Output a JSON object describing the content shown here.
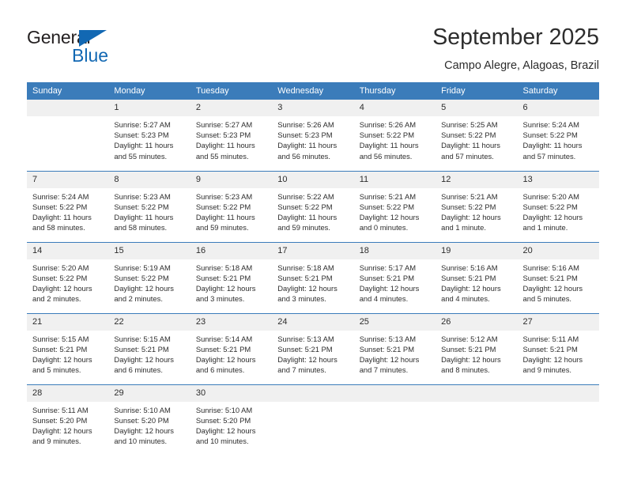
{
  "brand": {
    "name_part1": "General",
    "name_part2": "Blue",
    "accent_color": "#1268b3"
  },
  "header": {
    "title": "September 2025",
    "subtitle": "Campo Alegre, Alagoas, Brazil"
  },
  "calendar": {
    "header_color": "#3b7cba",
    "weekday_headers": [
      "Sunday",
      "Monday",
      "Tuesday",
      "Wednesday",
      "Thursday",
      "Friday",
      "Saturday"
    ],
    "weeks": [
      [
        {
          "day": "",
          "sunrise": "",
          "sunset": "",
          "daylight1": "",
          "daylight2": "",
          "blank": true
        },
        {
          "day": "1",
          "sunrise": "Sunrise: 5:27 AM",
          "sunset": "Sunset: 5:23 PM",
          "daylight1": "Daylight: 11 hours",
          "daylight2": "and 55 minutes."
        },
        {
          "day": "2",
          "sunrise": "Sunrise: 5:27 AM",
          "sunset": "Sunset: 5:23 PM",
          "daylight1": "Daylight: 11 hours",
          "daylight2": "and 55 minutes."
        },
        {
          "day": "3",
          "sunrise": "Sunrise: 5:26 AM",
          "sunset": "Sunset: 5:23 PM",
          "daylight1": "Daylight: 11 hours",
          "daylight2": "and 56 minutes."
        },
        {
          "day": "4",
          "sunrise": "Sunrise: 5:26 AM",
          "sunset": "Sunset: 5:22 PM",
          "daylight1": "Daylight: 11 hours",
          "daylight2": "and 56 minutes."
        },
        {
          "day": "5",
          "sunrise": "Sunrise: 5:25 AM",
          "sunset": "Sunset: 5:22 PM",
          "daylight1": "Daylight: 11 hours",
          "daylight2": "and 57 minutes."
        },
        {
          "day": "6",
          "sunrise": "Sunrise: 5:24 AM",
          "sunset": "Sunset: 5:22 PM",
          "daylight1": "Daylight: 11 hours",
          "daylight2": "and 57 minutes."
        }
      ],
      [
        {
          "day": "7",
          "sunrise": "Sunrise: 5:24 AM",
          "sunset": "Sunset: 5:22 PM",
          "daylight1": "Daylight: 11 hours",
          "daylight2": "and 58 minutes."
        },
        {
          "day": "8",
          "sunrise": "Sunrise: 5:23 AM",
          "sunset": "Sunset: 5:22 PM",
          "daylight1": "Daylight: 11 hours",
          "daylight2": "and 58 minutes."
        },
        {
          "day": "9",
          "sunrise": "Sunrise: 5:23 AM",
          "sunset": "Sunset: 5:22 PM",
          "daylight1": "Daylight: 11 hours",
          "daylight2": "and 59 minutes."
        },
        {
          "day": "10",
          "sunrise": "Sunrise: 5:22 AM",
          "sunset": "Sunset: 5:22 PM",
          "daylight1": "Daylight: 11 hours",
          "daylight2": "and 59 minutes."
        },
        {
          "day": "11",
          "sunrise": "Sunrise: 5:21 AM",
          "sunset": "Sunset: 5:22 PM",
          "daylight1": "Daylight: 12 hours",
          "daylight2": "and 0 minutes."
        },
        {
          "day": "12",
          "sunrise": "Sunrise: 5:21 AM",
          "sunset": "Sunset: 5:22 PM",
          "daylight1": "Daylight: 12 hours",
          "daylight2": "and 1 minute."
        },
        {
          "day": "13",
          "sunrise": "Sunrise: 5:20 AM",
          "sunset": "Sunset: 5:22 PM",
          "daylight1": "Daylight: 12 hours",
          "daylight2": "and 1 minute."
        }
      ],
      [
        {
          "day": "14",
          "sunrise": "Sunrise: 5:20 AM",
          "sunset": "Sunset: 5:22 PM",
          "daylight1": "Daylight: 12 hours",
          "daylight2": "and 2 minutes."
        },
        {
          "day": "15",
          "sunrise": "Sunrise: 5:19 AM",
          "sunset": "Sunset: 5:22 PM",
          "daylight1": "Daylight: 12 hours",
          "daylight2": "and 2 minutes."
        },
        {
          "day": "16",
          "sunrise": "Sunrise: 5:18 AM",
          "sunset": "Sunset: 5:21 PM",
          "daylight1": "Daylight: 12 hours",
          "daylight2": "and 3 minutes."
        },
        {
          "day": "17",
          "sunrise": "Sunrise: 5:18 AM",
          "sunset": "Sunset: 5:21 PM",
          "daylight1": "Daylight: 12 hours",
          "daylight2": "and 3 minutes."
        },
        {
          "day": "18",
          "sunrise": "Sunrise: 5:17 AM",
          "sunset": "Sunset: 5:21 PM",
          "daylight1": "Daylight: 12 hours",
          "daylight2": "and 4 minutes."
        },
        {
          "day": "19",
          "sunrise": "Sunrise: 5:16 AM",
          "sunset": "Sunset: 5:21 PM",
          "daylight1": "Daylight: 12 hours",
          "daylight2": "and 4 minutes."
        },
        {
          "day": "20",
          "sunrise": "Sunrise: 5:16 AM",
          "sunset": "Sunset: 5:21 PM",
          "daylight1": "Daylight: 12 hours",
          "daylight2": "and 5 minutes."
        }
      ],
      [
        {
          "day": "21",
          "sunrise": "Sunrise: 5:15 AM",
          "sunset": "Sunset: 5:21 PM",
          "daylight1": "Daylight: 12 hours",
          "daylight2": "and 5 minutes."
        },
        {
          "day": "22",
          "sunrise": "Sunrise: 5:15 AM",
          "sunset": "Sunset: 5:21 PM",
          "daylight1": "Daylight: 12 hours",
          "daylight2": "and 6 minutes."
        },
        {
          "day": "23",
          "sunrise": "Sunrise: 5:14 AM",
          "sunset": "Sunset: 5:21 PM",
          "daylight1": "Daylight: 12 hours",
          "daylight2": "and 6 minutes."
        },
        {
          "day": "24",
          "sunrise": "Sunrise: 5:13 AM",
          "sunset": "Sunset: 5:21 PM",
          "daylight1": "Daylight: 12 hours",
          "daylight2": "and 7 minutes."
        },
        {
          "day": "25",
          "sunrise": "Sunrise: 5:13 AM",
          "sunset": "Sunset: 5:21 PM",
          "daylight1": "Daylight: 12 hours",
          "daylight2": "and 7 minutes."
        },
        {
          "day": "26",
          "sunrise": "Sunrise: 5:12 AM",
          "sunset": "Sunset: 5:21 PM",
          "daylight1": "Daylight: 12 hours",
          "daylight2": "and 8 minutes."
        },
        {
          "day": "27",
          "sunrise": "Sunrise: 5:11 AM",
          "sunset": "Sunset: 5:21 PM",
          "daylight1": "Daylight: 12 hours",
          "daylight2": "and 9 minutes."
        }
      ],
      [
        {
          "day": "28",
          "sunrise": "Sunrise: 5:11 AM",
          "sunset": "Sunset: 5:20 PM",
          "daylight1": "Daylight: 12 hours",
          "daylight2": "and 9 minutes."
        },
        {
          "day": "29",
          "sunrise": "Sunrise: 5:10 AM",
          "sunset": "Sunset: 5:20 PM",
          "daylight1": "Daylight: 12 hours",
          "daylight2": "and 10 minutes."
        },
        {
          "day": "30",
          "sunrise": "Sunrise: 5:10 AM",
          "sunset": "Sunset: 5:20 PM",
          "daylight1": "Daylight: 12 hours",
          "daylight2": "and 10 minutes."
        },
        {
          "day": "",
          "sunrise": "",
          "sunset": "",
          "daylight1": "",
          "daylight2": "",
          "blank": true
        },
        {
          "day": "",
          "sunrise": "",
          "sunset": "",
          "daylight1": "",
          "daylight2": "",
          "blank": true
        },
        {
          "day": "",
          "sunrise": "",
          "sunset": "",
          "daylight1": "",
          "daylight2": "",
          "blank": true
        },
        {
          "day": "",
          "sunrise": "",
          "sunset": "",
          "daylight1": "",
          "daylight2": "",
          "blank": true
        }
      ]
    ]
  }
}
